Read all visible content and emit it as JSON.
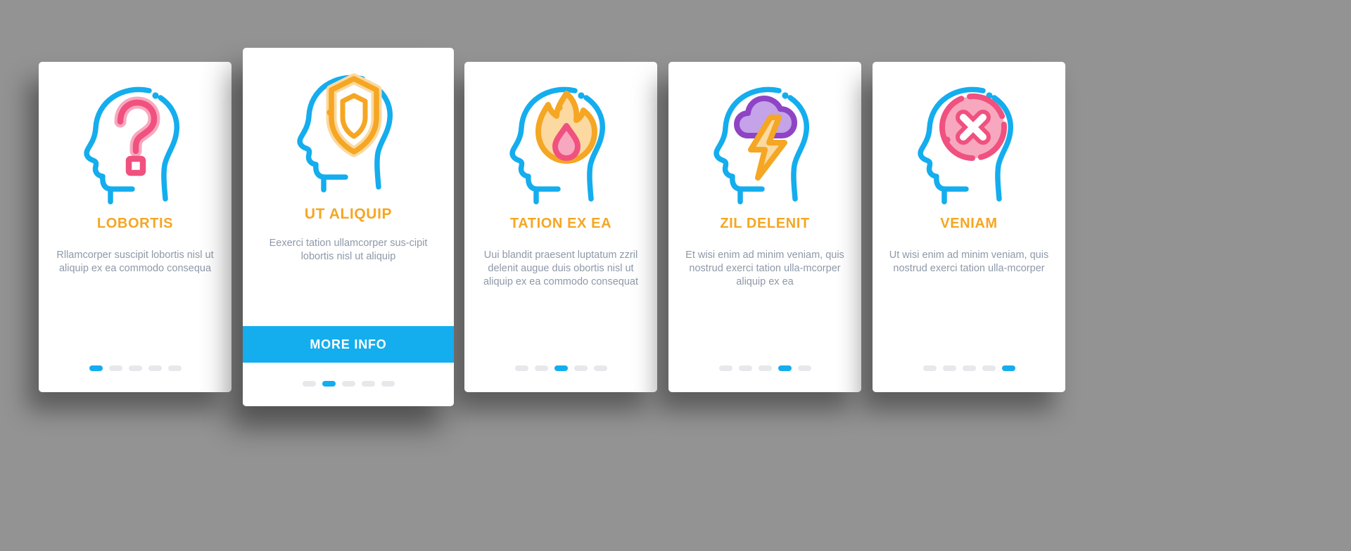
{
  "background_color": "#939393",
  "theme": {
    "title_color": "#F5A623",
    "body_color": "#8E99A8",
    "accent_blue": "#14ADEE",
    "dot_inactive": "#E6E8EB",
    "card_bg": "#FFFFFF",
    "pink": "#F0517F",
    "pink_light": "#F7A8BF",
    "orange": "#F5A623",
    "orange_light": "#FBD9A0",
    "purple": "#8E44C4",
    "purple_light": "#C4A3E8"
  },
  "cards": [
    {
      "id": "card-lobortis",
      "icon_name": "head-question-mark-icon",
      "title": "LOBORTIS",
      "body": "Rllamcorper suscipit lobortis nisl ut aliquip ex ea commodo consequa",
      "featured": false,
      "dots": {
        "count": 5,
        "active_index": 0
      }
    },
    {
      "id": "card-ut-aliquip",
      "icon_name": "head-shield-icon",
      "title": "UT ALIQUIP",
      "body": "Eexerci tation ullamcorper sus-cipit lobortis nisl ut aliquip",
      "featured": true,
      "button_label": "MORE INFO",
      "dots": {
        "count": 5,
        "active_index": 1
      }
    },
    {
      "id": "card-tation-ex-ea",
      "icon_name": "head-fire-icon",
      "title": "TATION EX EA",
      "body": "Uui blandit praesent luptatum zzril delenit augue duis obortis nisl ut aliquip ex ea commodo consequat",
      "featured": false,
      "dots": {
        "count": 5,
        "active_index": 2
      }
    },
    {
      "id": "card-zil-delenit",
      "icon_name": "head-storm-cloud-icon",
      "title": "ZIL DELENIT",
      "body": "Et wisi enim ad minim veniam, quis nostrud exerci tation ulla-mcorper aliquip ex ea",
      "featured": false,
      "dots": {
        "count": 5,
        "active_index": 3
      }
    },
    {
      "id": "card-veniam",
      "icon_name": "head-x-circle-icon",
      "title": "VENIAM",
      "body": "Ut wisi enim ad minim veniam, quis nostrud exerci tation ulla-mcorper",
      "featured": false,
      "dots": {
        "count": 5,
        "active_index": 4
      }
    }
  ]
}
